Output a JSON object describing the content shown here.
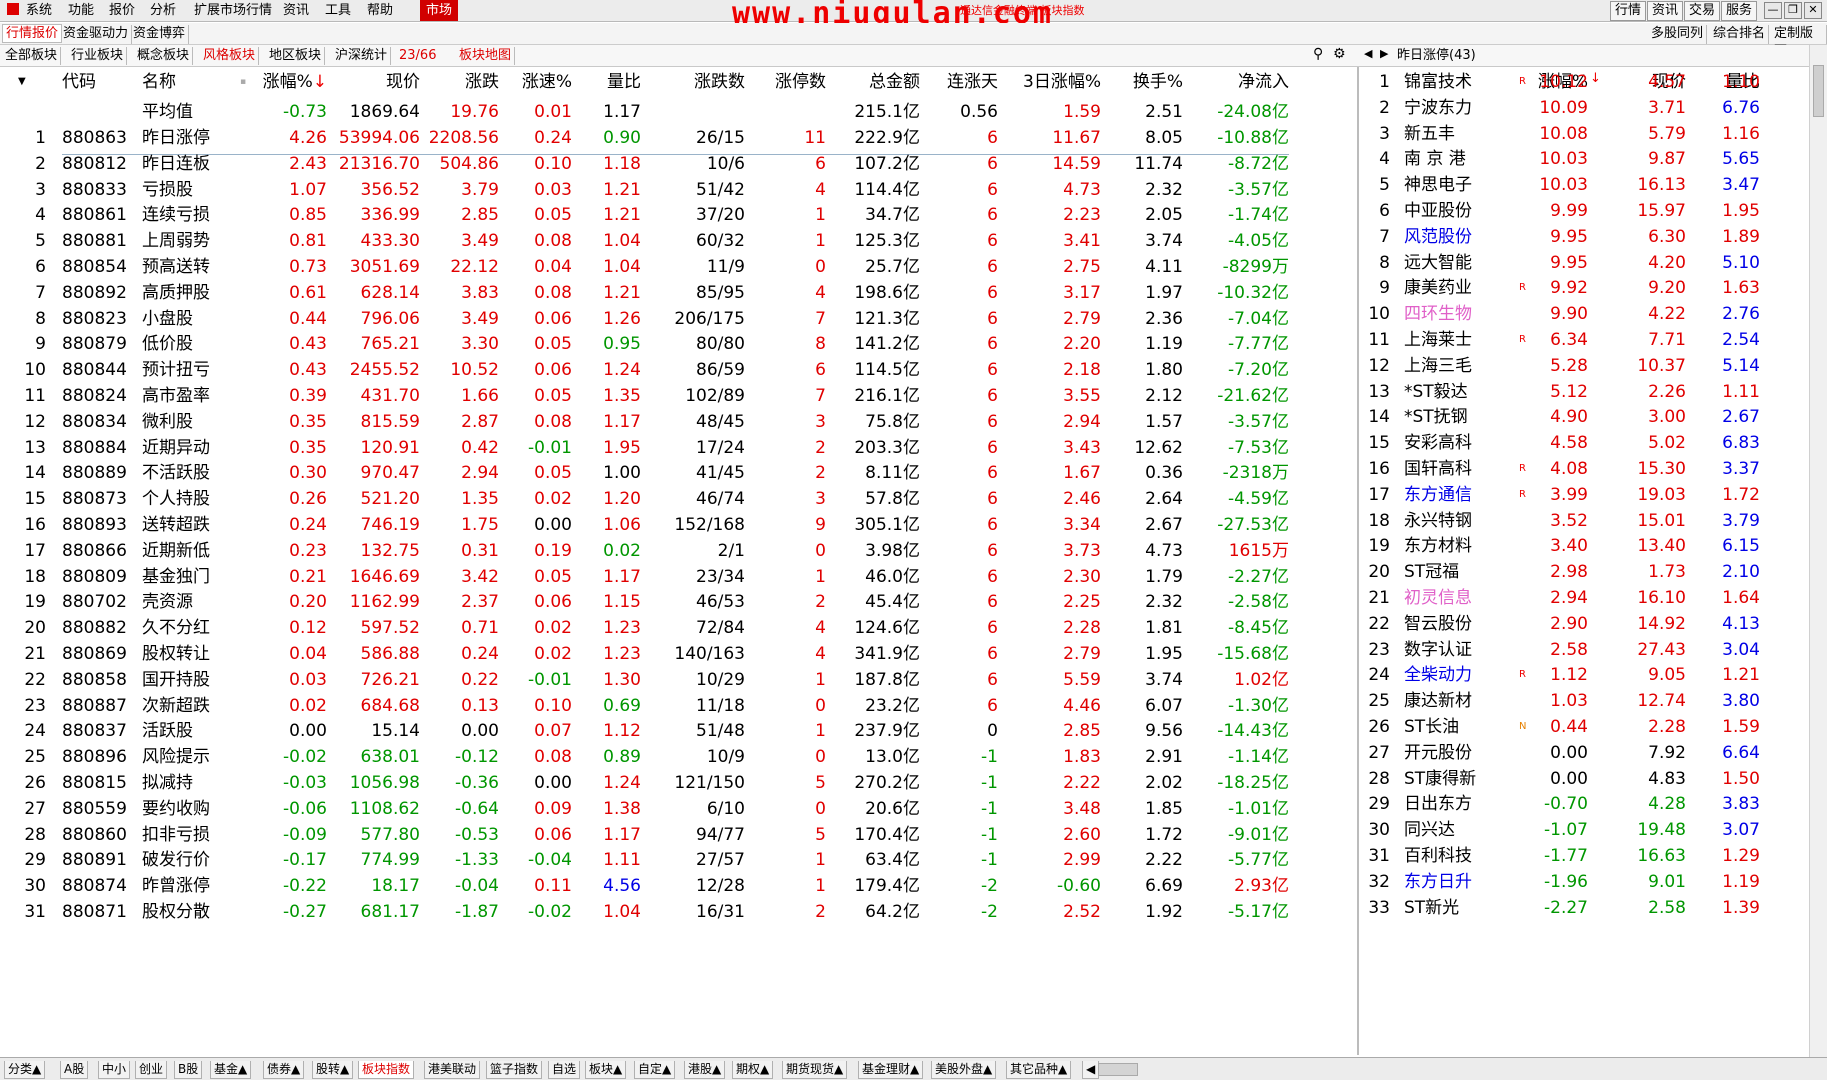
{
  "menu": {
    "items": [
      "系统",
      "功能",
      "报价",
      "分析",
      "扩展市场行情",
      "资讯",
      "工具",
      "帮助"
    ],
    "active": "市场",
    "watermark": "www.niugulan.com",
    "watermark_sub": "通达信金融终端 板块指数",
    "right_buttons": [
      "行情",
      "资讯",
      "交易",
      "服务"
    ]
  },
  "tabs2": {
    "items": [
      "行情报价",
      "资金驱动力",
      "资金博弈"
    ],
    "right": [
      "多股同列",
      "综合排名",
      "定制版面"
    ]
  },
  "tabs3": {
    "items": [
      "全部板块",
      "行业板块",
      "概念板块",
      "风格板块",
      "地区板块",
      "沪深统计"
    ],
    "active_index": 3,
    "count": "23/66",
    "map": "板块地图"
  },
  "table": {
    "headers": [
      "代码",
      "名称",
      "涨幅%",
      "现价",
      "涨跌",
      "涨速%",
      "量比",
      "涨跌数",
      "涨停数",
      "总金额",
      "连涨天",
      "3日涨幅%",
      "换手%",
      "净流入"
    ],
    "avg": {
      "name": "平均值",
      "pct": "-0.73",
      "price": "1869.64",
      "chg": "19.76",
      "speed": "0.01",
      "vr": "1.17",
      "amount": "215.1亿",
      "days": "0.56",
      "d3": "1.59",
      "turn": "2.51",
      "flow": "-24.08亿"
    },
    "rows": [
      [
        "1",
        "880863",
        "昨日涨停",
        "4.26",
        "53994.06",
        "2208.56",
        "0.24",
        "0.90",
        "26/15",
        "11",
        "222.9亿",
        "6",
        "11.67",
        "8.05",
        "-10.88亿"
      ],
      [
        "2",
        "880812",
        "昨日连板",
        "2.43",
        "21316.70",
        "504.86",
        "0.10",
        "1.18",
        "10/6",
        "6",
        "107.2亿",
        "6",
        "14.59",
        "11.74",
        "-8.72亿"
      ],
      [
        "3",
        "880833",
        "亏损股",
        "1.07",
        "356.52",
        "3.79",
        "0.03",
        "1.21",
        "51/42",
        "4",
        "114.4亿",
        "6",
        "4.73",
        "2.32",
        "-3.57亿"
      ],
      [
        "4",
        "880861",
        "连续亏损",
        "0.85",
        "336.99",
        "2.85",
        "0.05",
        "1.21",
        "37/20",
        "1",
        "34.7亿",
        "6",
        "2.23",
        "2.05",
        "-1.74亿"
      ],
      [
        "5",
        "880881",
        "上周弱势",
        "0.81",
        "433.30",
        "3.49",
        "0.08",
        "1.04",
        "60/32",
        "1",
        "125.3亿",
        "6",
        "3.41",
        "3.74",
        "-4.05亿"
      ],
      [
        "6",
        "880854",
        "预高送转",
        "0.73",
        "3051.69",
        "22.12",
        "0.04",
        "1.04",
        "11/9",
        "0",
        "25.7亿",
        "6",
        "2.75",
        "4.11",
        "-8299万"
      ],
      [
        "7",
        "880892",
        "高质押股",
        "0.61",
        "628.14",
        "3.83",
        "0.08",
        "1.21",
        "85/95",
        "4",
        "198.6亿",
        "6",
        "3.17",
        "1.97",
        "-10.32亿"
      ],
      [
        "8",
        "880823",
        "小盘股",
        "0.44",
        "796.06",
        "3.49",
        "0.06",
        "1.26",
        "206/175",
        "7",
        "121.3亿",
        "6",
        "2.79",
        "2.36",
        "-7.04亿"
      ],
      [
        "9",
        "880879",
        "低价股",
        "0.43",
        "765.21",
        "3.30",
        "0.05",
        "0.95",
        "80/80",
        "8",
        "141.2亿",
        "6",
        "2.20",
        "1.19",
        "-7.77亿"
      ],
      [
        "10",
        "880844",
        "预计扭亏",
        "0.43",
        "2455.52",
        "10.52",
        "0.06",
        "1.24",
        "86/59",
        "6",
        "114.5亿",
        "6",
        "2.18",
        "1.80",
        "-7.20亿"
      ],
      [
        "11",
        "880824",
        "高市盈率",
        "0.39",
        "431.70",
        "1.66",
        "0.05",
        "1.35",
        "102/89",
        "7",
        "216.1亿",
        "6",
        "3.55",
        "2.12",
        "-21.62亿"
      ],
      [
        "12",
        "880834",
        "微利股",
        "0.35",
        "815.59",
        "2.87",
        "0.08",
        "1.17",
        "48/45",
        "3",
        "75.8亿",
        "6",
        "2.94",
        "1.57",
        "-3.57亿"
      ],
      [
        "13",
        "880884",
        "近期异动",
        "0.35",
        "120.91",
        "0.42",
        "-0.01",
        "1.95",
        "17/24",
        "2",
        "203.3亿",
        "6",
        "3.43",
        "12.62",
        "-7.53亿"
      ],
      [
        "14",
        "880889",
        "不活跃股",
        "0.30",
        "970.47",
        "2.94",
        "0.05",
        "1.00",
        "41/45",
        "2",
        "8.11亿",
        "6",
        "1.67",
        "0.36",
        "-2318万"
      ],
      [
        "15",
        "880873",
        "个人持股",
        "0.26",
        "521.20",
        "1.35",
        "0.02",
        "1.20",
        "46/74",
        "3",
        "57.8亿",
        "6",
        "2.46",
        "2.64",
        "-4.59亿"
      ],
      [
        "16",
        "880893",
        "送转超跌",
        "0.24",
        "746.19",
        "1.75",
        "0.00",
        "1.06",
        "152/168",
        "9",
        "305.1亿",
        "6",
        "3.34",
        "2.67",
        "-27.53亿"
      ],
      [
        "17",
        "880866",
        "近期新低",
        "0.23",
        "132.75",
        "0.31",
        "0.19",
        "0.02",
        "2/1",
        "0",
        "3.98亿",
        "6",
        "3.73",
        "4.73",
        "1615万"
      ],
      [
        "18",
        "880809",
        "基金独门",
        "0.21",
        "1646.69",
        "3.42",
        "0.05",
        "1.17",
        "23/34",
        "1",
        "46.0亿",
        "6",
        "2.30",
        "1.79",
        "-2.27亿"
      ],
      [
        "19",
        "880702",
        "壳资源",
        "0.20",
        "1162.99",
        "2.37",
        "0.06",
        "1.15",
        "46/53",
        "2",
        "45.4亿",
        "6",
        "2.25",
        "2.32",
        "-2.58亿"
      ],
      [
        "20",
        "880882",
        "久不分红",
        "0.12",
        "597.52",
        "0.71",
        "0.02",
        "1.23",
        "72/84",
        "4",
        "124.6亿",
        "6",
        "2.28",
        "1.81",
        "-8.45亿"
      ],
      [
        "21",
        "880869",
        "股权转让",
        "0.04",
        "586.88",
        "0.24",
        "0.02",
        "1.23",
        "140/163",
        "4",
        "341.9亿",
        "6",
        "2.79",
        "1.95",
        "-15.68亿"
      ],
      [
        "22",
        "880858",
        "国开持股",
        "0.03",
        "726.21",
        "0.22",
        "-0.01",
        "1.30",
        "10/29",
        "1",
        "187.8亿",
        "6",
        "5.59",
        "3.74",
        "1.02亿"
      ],
      [
        "23",
        "880887",
        "次新超跌",
        "0.02",
        "684.68",
        "0.13",
        "0.10",
        "0.69",
        "11/18",
        "0",
        "23.2亿",
        "6",
        "4.46",
        "6.07",
        "-1.30亿"
      ],
      [
        "24",
        "880837",
        "活跃股",
        "0.00",
        "15.14",
        "0.00",
        "0.07",
        "1.12",
        "51/48",
        "1",
        "237.9亿",
        "0",
        "2.85",
        "9.56",
        "-14.43亿"
      ],
      [
        "25",
        "880896",
        "风险提示",
        "-0.02",
        "638.01",
        "-0.12",
        "0.08",
        "0.89",
        "10/9",
        "0",
        "13.0亿",
        "-1",
        "1.83",
        "2.91",
        "-1.14亿"
      ],
      [
        "26",
        "880815",
        "拟减持",
        "-0.03",
        "1056.98",
        "-0.36",
        "0.00",
        "1.24",
        "121/150",
        "5",
        "270.2亿",
        "-1",
        "2.22",
        "2.02",
        "-18.25亿"
      ],
      [
        "27",
        "880559",
        "要约收购",
        "-0.06",
        "1108.62",
        "-0.64",
        "0.09",
        "1.38",
        "6/10",
        "0",
        "20.6亿",
        "-1",
        "3.48",
        "1.85",
        "-1.01亿"
      ],
      [
        "28",
        "880860",
        "扣非亏损",
        "-0.09",
        "577.80",
        "-0.53",
        "0.06",
        "1.17",
        "94/77",
        "5",
        "170.4亿",
        "-1",
        "2.60",
        "1.72",
        "-9.01亿"
      ],
      [
        "29",
        "880891",
        "破发行价",
        "-0.17",
        "774.99",
        "-1.33",
        "-0.04",
        "1.11",
        "27/57",
        "1",
        "63.4亿",
        "-1",
        "2.99",
        "2.22",
        "-5.77亿"
      ],
      [
        "30",
        "880874",
        "昨曾涨停",
        "-0.22",
        "18.17",
        "-0.04",
        "0.11",
        "4.56",
        "12/28",
        "1",
        "179.4亿",
        "-2",
        "-0.60",
        "6.69",
        "2.93亿"
      ],
      [
        "31",
        "880871",
        "股权分散",
        "-0.27",
        "681.17",
        "-1.87",
        "-0.02",
        "1.04",
        "16/31",
        "2",
        "64.2亿",
        "-2",
        "2.52",
        "1.92",
        "-5.17亿"
      ]
    ]
  },
  "right_panel": {
    "title": "昨日涨停(43)",
    "headers": [
      "涨幅%",
      "现价",
      "量比"
    ],
    "rows": [
      [
        "1",
        "锦富技术",
        "R",
        "10.12",
        "4.57",
        "1.10",
        "n"
      ],
      [
        "2",
        "宁波东力",
        "",
        "10.09",
        "3.71",
        "6.76",
        "n"
      ],
      [
        "3",
        "新五丰",
        "",
        "10.08",
        "5.79",
        "1.16",
        "n"
      ],
      [
        "4",
        "南 京 港",
        "",
        "10.03",
        "9.87",
        "5.65",
        "n"
      ],
      [
        "5",
        "神思电子",
        "",
        "10.03",
        "16.13",
        "3.47",
        "n"
      ],
      [
        "6",
        "中亚股份",
        "",
        "9.99",
        "15.97",
        "1.95",
        "n"
      ],
      [
        "7",
        "风范股份",
        "",
        "9.95",
        "6.30",
        "1.89",
        "b"
      ],
      [
        "8",
        "远大智能",
        "",
        "9.95",
        "4.20",
        "5.10",
        "n"
      ],
      [
        "9",
        "康美药业",
        "R",
        "9.92",
        "9.20",
        "1.63",
        "n"
      ],
      [
        "10",
        "四环生物",
        "",
        "9.90",
        "4.22",
        "2.76",
        "p"
      ],
      [
        "11",
        "上海莱士",
        "R",
        "6.34",
        "7.71",
        "2.54",
        "n"
      ],
      [
        "12",
        "上海三毛",
        "",
        "5.28",
        "10.37",
        "5.14",
        "n"
      ],
      [
        "13",
        "*ST毅达",
        "",
        "5.12",
        "2.26",
        "1.11",
        "n"
      ],
      [
        "14",
        "*ST抚钢",
        "",
        "4.90",
        "3.00",
        "2.67",
        "n"
      ],
      [
        "15",
        "安彩高科",
        "",
        "4.58",
        "5.02",
        "6.83",
        "n"
      ],
      [
        "16",
        "国轩高科",
        "R",
        "4.08",
        "15.30",
        "3.37",
        "n"
      ],
      [
        "17",
        "东方通信",
        "R",
        "3.99",
        "19.03",
        "1.72",
        "b"
      ],
      [
        "18",
        "永兴特钢",
        "",
        "3.52",
        "15.01",
        "3.79",
        "n"
      ],
      [
        "19",
        "东方材料",
        "",
        "3.40",
        "13.40",
        "6.15",
        "n"
      ],
      [
        "20",
        "ST冠福",
        "",
        "2.98",
        "1.73",
        "2.10",
        "n"
      ],
      [
        "21",
        "初灵信息",
        "",
        "2.94",
        "16.10",
        "1.64",
        "p"
      ],
      [
        "22",
        "智云股份",
        "",
        "2.90",
        "14.92",
        "4.13",
        "n"
      ],
      [
        "23",
        "数字认证",
        "",
        "2.58",
        "27.43",
        "3.04",
        "n"
      ],
      [
        "24",
        "全柴动力",
        "R",
        "1.12",
        "9.05",
        "1.21",
        "b"
      ],
      [
        "25",
        "康达新材",
        "",
        "1.03",
        "12.74",
        "3.80",
        "n"
      ],
      [
        "26",
        "ST长油",
        "N",
        "0.44",
        "2.28",
        "1.59",
        "n"
      ],
      [
        "27",
        "开元股份",
        "",
        "0.00",
        "7.92",
        "6.64",
        "n"
      ],
      [
        "28",
        "ST康得新",
        "",
        "0.00",
        "4.83",
        "1.50",
        "n"
      ],
      [
        "29",
        "日出东方",
        "",
        "-0.70",
        "4.28",
        "3.83",
        "n"
      ],
      [
        "30",
        "同兴达",
        "",
        "-1.07",
        "19.48",
        "3.07",
        "n"
      ],
      [
        "31",
        "百利科技",
        "",
        "-1.77",
        "16.63",
        "1.29",
        "n"
      ],
      [
        "32",
        "东方日升",
        "",
        "-1.96",
        "9.01",
        "1.19",
        "b"
      ],
      [
        "33",
        "ST新光",
        "",
        "-2.27",
        "2.58",
        "1.39",
        "n"
      ]
    ]
  },
  "bottom": {
    "items": [
      "分类▲",
      "A股",
      "中小",
      "创业",
      "B股",
      "基金▲",
      "债券▲",
      "股转▲",
      "板块指数",
      "港美联动",
      "篮子指数",
      "自选",
      "板块▲",
      "自定▲",
      "港股▲",
      "期权▲",
      "期货现货▲",
      "基金理财▲",
      "美股外盘▲",
      "其它品种▲"
    ],
    "active_index": 8
  },
  "colors": {
    "up": "#e00000",
    "down": "#009600",
    "blue": "#0000e6",
    "pink": "#e060c8"
  }
}
